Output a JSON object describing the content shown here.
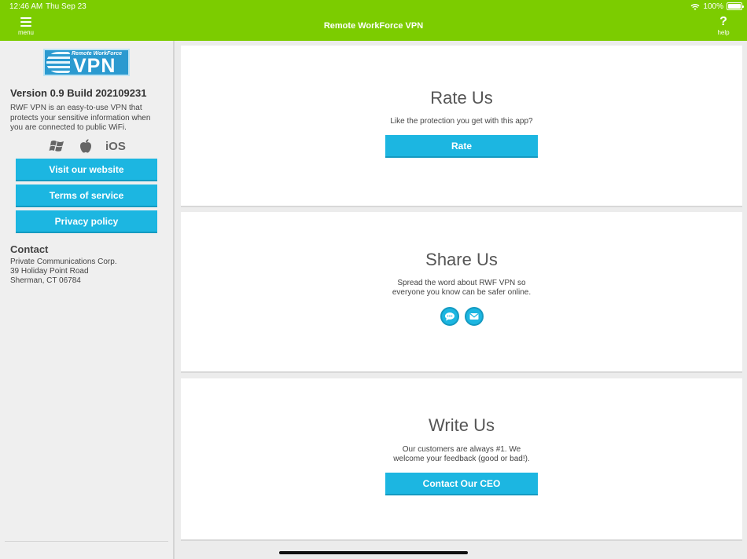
{
  "status": {
    "time": "12:46 AM",
    "date": "Thu Sep 23",
    "battery": "100%"
  },
  "header": {
    "title": "Remote WorkForce VPN",
    "menu_label": "menu",
    "help_label": "help",
    "help_glyph": "?"
  },
  "sidebar": {
    "logo_top": "Remote WorkForce",
    "logo_main": "VPN",
    "version": "Version 0.9 Build 202109231",
    "description": "RWF VPN is an easy-to-use VPN that protects your sensitive information when you are connected to public WiFi.",
    "platforms": [
      "windows-icon",
      "apple-icon"
    ],
    "ios_label": "iOS",
    "buttons": [
      "Visit our website",
      "Terms of service",
      "Privacy policy"
    ],
    "contact_heading": "Contact",
    "contact_lines": [
      "Private Communications Corp.",
      "39 Holiday Point Road",
      "Sherman, CT 06784"
    ]
  },
  "cards": {
    "rate": {
      "title": "Rate Us",
      "text": "Like the protection you get with this app?",
      "button": "Rate"
    },
    "share": {
      "title": "Share Us",
      "text_line1": "Spread the word about RWF VPN so",
      "text_line2": "everyone you know can be safer online.",
      "icons": [
        "message-icon",
        "mail-icon"
      ]
    },
    "write": {
      "title": "Write Us",
      "text_line1": "Our customers are always #1. We",
      "text_line2": "welcome your feedback (good or bad!).",
      "button": "Contact Our CEO"
    }
  },
  "colors": {
    "header": "#7ccc00",
    "button": "#1cb6e1",
    "background": "#ececec"
  }
}
